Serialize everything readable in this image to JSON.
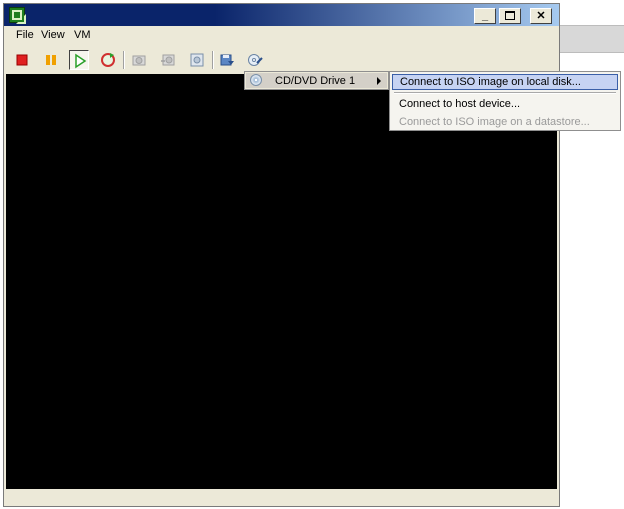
{
  "menubar": {
    "items": [
      "File",
      "View",
      "VM"
    ]
  },
  "toolbar": {
    "buttons": [
      {
        "name": "power-off-button",
        "icon": "stop-icon",
        "color": "#e02020"
      },
      {
        "name": "suspend-button",
        "icon": "pause-icon",
        "color": "#f0a000"
      },
      {
        "name": "power-on-button",
        "icon": "play-icon",
        "color": "#2aa02a"
      },
      {
        "name": "reset-button",
        "icon": "reset-icon",
        "color": "#d03030"
      },
      {
        "name": "snapshot-button",
        "icon": "snapshot-icon"
      },
      {
        "name": "revert-snapshot-button",
        "icon": "revert-snapshot-icon"
      },
      {
        "name": "snapshot-manager-button",
        "icon": "snapshot-manager-icon"
      },
      {
        "name": "connect-floppy-button",
        "icon": "floppy-icon"
      },
      {
        "name": "connect-cd-button",
        "icon": "cd-icon"
      }
    ]
  },
  "cd_menu": {
    "label": "CD/DVD Drive 1"
  },
  "cd_submenu": {
    "options": [
      "Connect to ISO image on local disk...",
      "Connect to host device...",
      "Connect to ISO image on a datastore..."
    ]
  },
  "colors": {
    "titlebar_start": "#0a246a",
    "titlebar_end": "#a6caf0",
    "console": "#000000",
    "highlight": "#c6d3f3"
  }
}
